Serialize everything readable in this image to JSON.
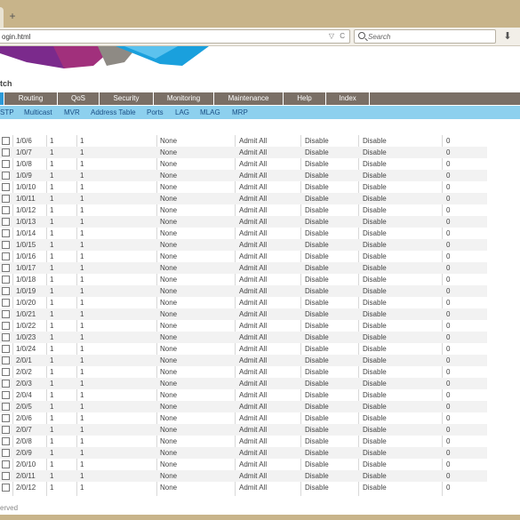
{
  "browser": {
    "new_tab_symbol": "+",
    "url": "ogin.html",
    "url_icons": "▽ C",
    "search_placeholder": "Search",
    "download_symbol": "⬇"
  },
  "page": {
    "title": "tch",
    "footer": "erved"
  },
  "main_menu": [
    "Routing",
    "QoS",
    "Security",
    "Monitoring",
    "Maintenance",
    "Help",
    "Index"
  ],
  "sub_menu": [
    "STP",
    "Multicast",
    "MVR",
    "Address Table",
    "Ports",
    "LAG",
    "MLAG",
    "MRP"
  ],
  "colors": {
    "menu_bg": "#7a6f66",
    "submenu_bg": "#8dd0ee",
    "logo_purple": "#7b2a8c",
    "logo_blue": "#1aa0dd"
  },
  "table": {
    "rows": [
      {
        "port": "1/0/6",
        "c2": "1",
        "c3": "1",
        "c4": "None",
        "c5": "Admit All",
        "c6": "Disable",
        "c7": "Disable",
        "c8": "0"
      },
      {
        "port": "1/0/7",
        "c2": "1",
        "c3": "1",
        "c4": "None",
        "c5": "Admit All",
        "c6": "Disable",
        "c7": "Disable",
        "c8": "0"
      },
      {
        "port": "1/0/8",
        "c2": "1",
        "c3": "1",
        "c4": "None",
        "c5": "Admit All",
        "c6": "Disable",
        "c7": "Disable",
        "c8": "0"
      },
      {
        "port": "1/0/9",
        "c2": "1",
        "c3": "1",
        "c4": "None",
        "c5": "Admit All",
        "c6": "Disable",
        "c7": "Disable",
        "c8": "0"
      },
      {
        "port": "1/0/10",
        "c2": "1",
        "c3": "1",
        "c4": "None",
        "c5": "Admit All",
        "c6": "Disable",
        "c7": "Disable",
        "c8": "0"
      },
      {
        "port": "1/0/11",
        "c2": "1",
        "c3": "1",
        "c4": "None",
        "c5": "Admit All",
        "c6": "Disable",
        "c7": "Disable",
        "c8": "0"
      },
      {
        "port": "1/0/12",
        "c2": "1",
        "c3": "1",
        "c4": "None",
        "c5": "Admit All",
        "c6": "Disable",
        "c7": "Disable",
        "c8": "0"
      },
      {
        "port": "1/0/13",
        "c2": "1",
        "c3": "1",
        "c4": "None",
        "c5": "Admit All",
        "c6": "Disable",
        "c7": "Disable",
        "c8": "0"
      },
      {
        "port": "1/0/14",
        "c2": "1",
        "c3": "1",
        "c4": "None",
        "c5": "Admit All",
        "c6": "Disable",
        "c7": "Disable",
        "c8": "0"
      },
      {
        "port": "1/0/15",
        "c2": "1",
        "c3": "1",
        "c4": "None",
        "c5": "Admit All",
        "c6": "Disable",
        "c7": "Disable",
        "c8": "0"
      },
      {
        "port": "1/0/16",
        "c2": "1",
        "c3": "1",
        "c4": "None",
        "c5": "Admit All",
        "c6": "Disable",
        "c7": "Disable",
        "c8": "0"
      },
      {
        "port": "1/0/17",
        "c2": "1",
        "c3": "1",
        "c4": "None",
        "c5": "Admit All",
        "c6": "Disable",
        "c7": "Disable",
        "c8": "0"
      },
      {
        "port": "1/0/18",
        "c2": "1",
        "c3": "1",
        "c4": "None",
        "c5": "Admit All",
        "c6": "Disable",
        "c7": "Disable",
        "c8": "0"
      },
      {
        "port": "1/0/19",
        "c2": "1",
        "c3": "1",
        "c4": "None",
        "c5": "Admit All",
        "c6": "Disable",
        "c7": "Disable",
        "c8": "0"
      },
      {
        "port": "1/0/20",
        "c2": "1",
        "c3": "1",
        "c4": "None",
        "c5": "Admit All",
        "c6": "Disable",
        "c7": "Disable",
        "c8": "0"
      },
      {
        "port": "1/0/21",
        "c2": "1",
        "c3": "1",
        "c4": "None",
        "c5": "Admit All",
        "c6": "Disable",
        "c7": "Disable",
        "c8": "0"
      },
      {
        "port": "1/0/22",
        "c2": "1",
        "c3": "1",
        "c4": "None",
        "c5": "Admit All",
        "c6": "Disable",
        "c7": "Disable",
        "c8": "0"
      },
      {
        "port": "1/0/23",
        "c2": "1",
        "c3": "1",
        "c4": "None",
        "c5": "Admit All",
        "c6": "Disable",
        "c7": "Disable",
        "c8": "0"
      },
      {
        "port": "1/0/24",
        "c2": "1",
        "c3": "1",
        "c4": "None",
        "c5": "Admit All",
        "c6": "Disable",
        "c7": "Disable",
        "c8": "0"
      },
      {
        "port": "2/0/1",
        "c2": "1",
        "c3": "1",
        "c4": "None",
        "c5": "Admit All",
        "c6": "Disable",
        "c7": "Disable",
        "c8": "0"
      },
      {
        "port": "2/0/2",
        "c2": "1",
        "c3": "1",
        "c4": "None",
        "c5": "Admit All",
        "c6": "Disable",
        "c7": "Disable",
        "c8": "0"
      },
      {
        "port": "2/0/3",
        "c2": "1",
        "c3": "1",
        "c4": "None",
        "c5": "Admit All",
        "c6": "Disable",
        "c7": "Disable",
        "c8": "0"
      },
      {
        "port": "2/0/4",
        "c2": "1",
        "c3": "1",
        "c4": "None",
        "c5": "Admit All",
        "c6": "Disable",
        "c7": "Disable",
        "c8": "0"
      },
      {
        "port": "2/0/5",
        "c2": "1",
        "c3": "1",
        "c4": "None",
        "c5": "Admit All",
        "c6": "Disable",
        "c7": "Disable",
        "c8": "0"
      },
      {
        "port": "2/0/6",
        "c2": "1",
        "c3": "1",
        "c4": "None",
        "c5": "Admit All",
        "c6": "Disable",
        "c7": "Disable",
        "c8": "0"
      },
      {
        "port": "2/0/7",
        "c2": "1",
        "c3": "1",
        "c4": "None",
        "c5": "Admit All",
        "c6": "Disable",
        "c7": "Disable",
        "c8": "0"
      },
      {
        "port": "2/0/8",
        "c2": "1",
        "c3": "1",
        "c4": "None",
        "c5": "Admit All",
        "c6": "Disable",
        "c7": "Disable",
        "c8": "0"
      },
      {
        "port": "2/0/9",
        "c2": "1",
        "c3": "1",
        "c4": "None",
        "c5": "Admit All",
        "c6": "Disable",
        "c7": "Disable",
        "c8": "0"
      },
      {
        "port": "2/0/10",
        "c2": "1",
        "c3": "1",
        "c4": "None",
        "c5": "Admit All",
        "c6": "Disable",
        "c7": "Disable",
        "c8": "0"
      },
      {
        "port": "2/0/11",
        "c2": "1",
        "c3": "1",
        "c4": "None",
        "c5": "Admit All",
        "c6": "Disable",
        "c7": "Disable",
        "c8": "0"
      },
      {
        "port": "2/0/12",
        "c2": "1",
        "c3": "1",
        "c4": "None",
        "c5": "Admit All",
        "c6": "Disable",
        "c7": "Disable",
        "c8": "0"
      }
    ]
  }
}
